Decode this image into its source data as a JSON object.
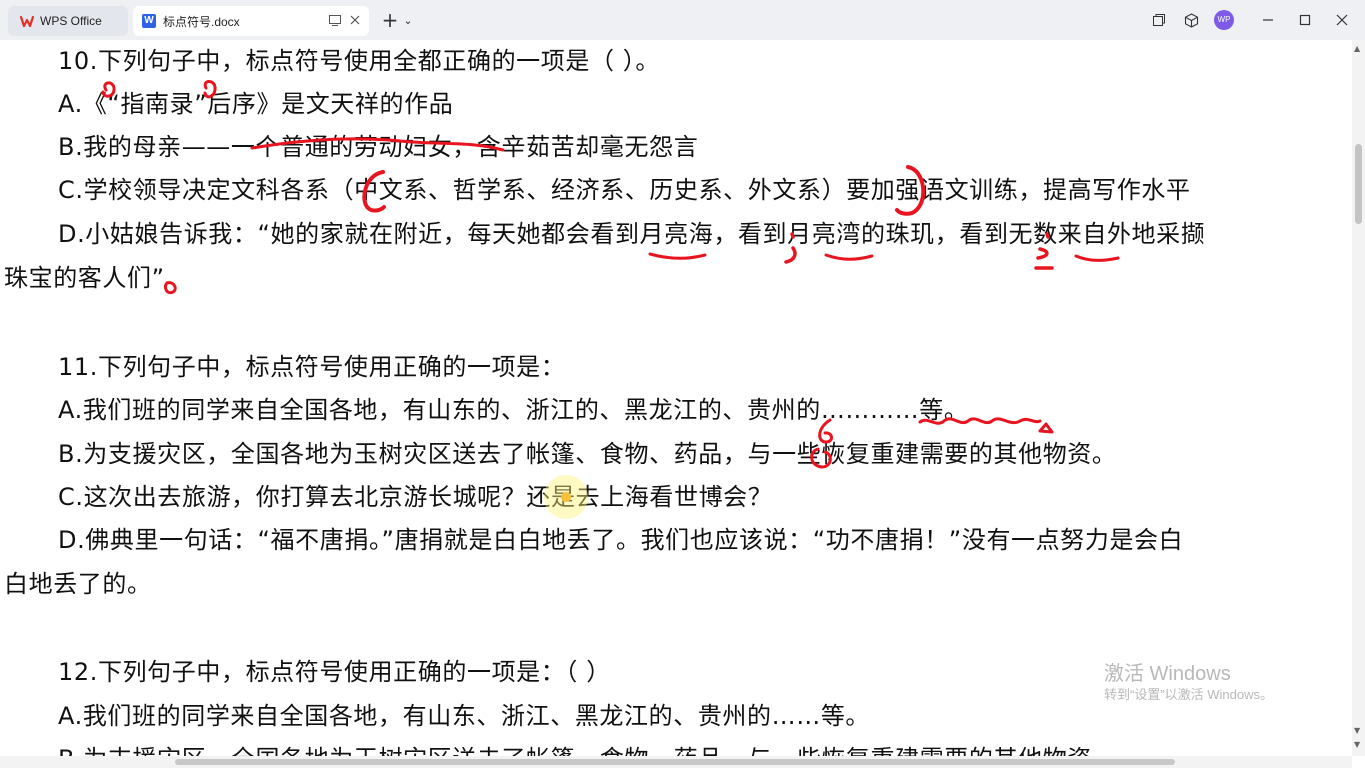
{
  "tabs": [
    {
      "label": "WPS Office",
      "icon": "wps-logo-icon"
    },
    {
      "label": "标点符号.docx",
      "icon": "word-doc-icon"
    }
  ],
  "titlebar": {
    "new_tab_symbol": "+",
    "new_tab_menu_symbol": "⌄",
    "avatar_initials": "WP"
  },
  "document": {
    "q10": {
      "stem": "10.下列句子中，标点符号使用全都正确的一项是（  ）。",
      "a": "A.《“指南录”后序》是文天祥的作品",
      "b": "B.我的母亲——一个普通的劳动妇女，含辛茹苦却毫无怨言",
      "c": "C.学校领导决定文科各系（中文系、哲学系、经济系、历史系、外文系）要加强语文训练，提高写作水平",
      "d": "D.小姑娘告诉我：“她的家就在附近，每天她都会看到月亮海，看到月亮湾的珠玑，看到无数来自外地采撷",
      "d_cont": "珠宝的客人们”"
    },
    "q11": {
      "stem": "11.下列句子中，标点符号使用正确的一项是：",
      "a": "A.我们班的同学来自全国各地，有山东的、浙江的、黑龙江的、贵州的…………等。",
      "b": "B.为支援灾区，全国各地为玉树灾区送去了帐篷、食物、药品，与一些恢复重建需要的其他物资。",
      "c": "C.这次出去旅游，你打算去北京游长城呢？还是去上海看世博会？",
      "d": "D.佛典里一句话：“福不唐捐。”唐捐就是白白地丢了。我们也应该说：“功不唐捐！”没有一点努力是会白",
      "d_cont": "白地丢了的。"
    },
    "q12": {
      "stem": "12.下列句子中，标点符号使用正确的一项是：（  ）",
      "a": "A.我们班的同学来自全国各地，有山东、浙江、黑龙江的、贵州的……等。",
      "b_partial": "B.为支援灾区，全国各地为玉树灾区送去了帐篷、食物、药品，与一些恢复重建需要的其他物资"
    }
  },
  "watermark": {
    "line1": "激活 Windows",
    "line2": "转到“设置”以激活 Windows。"
  },
  "colors": {
    "annotation_red": "#e8141f",
    "highlight_yellow": "#fff27a",
    "cursor_orange": "#f29a00",
    "wps_red": "#e0312b",
    "word_blue": "#2f62e8",
    "avatar_purple": "#7d5be6"
  }
}
